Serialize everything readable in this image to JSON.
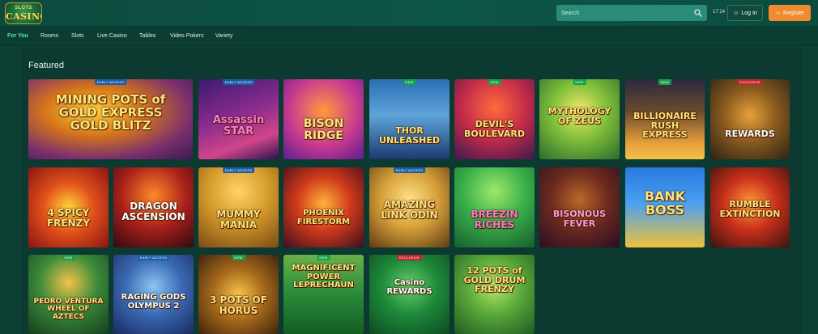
{
  "header": {
    "logo_top": "SLOTS",
    "logo_main": "CASINO",
    "search_placeholder": "Search",
    "clock": "17:14",
    "login_label": "Log In",
    "register_label": "Register"
  },
  "nav": {
    "items": [
      "For You",
      "Rooms",
      "Slots",
      "Live Casino",
      "Tables",
      "Video Pokers",
      "Variety"
    ]
  },
  "main": {
    "section_title": "Featured",
    "tiles": [
      {
        "title": "MINING POTS of GOLD EXPRESS GOLD BLITZ",
        "badge": "EARLY ACCESS"
      },
      {
        "title": "Assassin STAR",
        "badge": "EARLY ACCESS"
      },
      {
        "title": "BISON RIDGE",
        "badge": ""
      },
      {
        "title": "THOR UNLEASHED",
        "badge": "NEW"
      },
      {
        "title": "DEVIL'S BOULEVARD",
        "badge": "NEW"
      },
      {
        "title": "MYTHOLOGY OF ZEUS",
        "badge": "NEW"
      },
      {
        "title": "BILLIONAIRE RUSH EXPRESS",
        "badge": "NEW"
      },
      {
        "title": "REWARDS",
        "badge": "EXCLUSIVE"
      },
      {
        "title": "4 SPICY FRENZY",
        "badge": ""
      },
      {
        "title": "DRAGON ASCENSION",
        "badge": ""
      },
      {
        "title": "MUMMY MANIA",
        "badge": "EARLY ACCESS"
      },
      {
        "title": "PHOENIX FIRESTORM",
        "badge": ""
      },
      {
        "title": "AMAZING LINK ODIN",
        "badge": "EARLY ACCESS"
      },
      {
        "title": "BREEZIN RICHES",
        "badge": ""
      },
      {
        "title": "BISONOUS FEVER",
        "badge": ""
      },
      {
        "title": "BANK BOSS",
        "badge": ""
      },
      {
        "title": "RUMBLE EXTINCTION",
        "badge": ""
      },
      {
        "title": "PEDRO VENTURA WHEEL OF AZTECS",
        "badge": "NEW"
      },
      {
        "title": "RAGING GODS OLYMPUS 2",
        "badge": "EARLY ACCESS"
      },
      {
        "title": "3 POTS OF HORUS",
        "badge": "NEW"
      },
      {
        "title": "MAGNIFICENT POWER LEPRECHAUN",
        "badge": "NEW"
      },
      {
        "title": "Casino REWARDS",
        "badge": "EXCLUSIVE"
      },
      {
        "title": "12 POTS of GOLD DRUM FRENZY",
        "badge": ""
      }
    ]
  },
  "colors": {
    "background": "#0e3f35",
    "accent": "#56e0b8",
    "register": "#f08a2e",
    "search": "#2a8c78"
  },
  "icons": {
    "search": "search-icon",
    "login": "user-icon",
    "register": "user-plus-icon"
  }
}
